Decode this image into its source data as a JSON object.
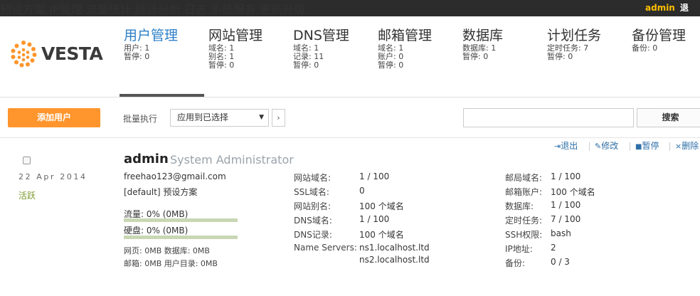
{
  "topnav": [
    "预设方案",
    "IP管理",
    "流量统计",
    "统计分析",
    "日志",
    "系统服务",
    "更新升级"
  ],
  "top_user": "admin",
  "top_logout": "退出",
  "logo_text": "VESTA",
  "colors": {
    "topbar": "#2c2c2c",
    "accent_orange": "#ff952c",
    "active_blue": "#2e80c8",
    "user_yellow": "#ffbf00",
    "status_green": "#7a9a2d"
  },
  "menu": [
    {
      "title": "用户管理",
      "stats": [
        "用户: 1",
        "暂停: 0"
      ]
    },
    {
      "title": "网站管理",
      "stats": [
        "域名: 1",
        "别名: 1",
        "暂停: 0"
      ]
    },
    {
      "title": "DNS管理",
      "stats": [
        "域名: 1",
        "记录: 11",
        "暂停: 0"
      ]
    },
    {
      "title": "邮箱管理",
      "stats": [
        "域名: 1",
        "账户: 0",
        "暂停: 0"
      ]
    },
    {
      "title": "数据库",
      "stats": [
        "数据库: 1",
        "暂停: 0"
      ]
    },
    {
      "title": "计划任务",
      "stats": [
        "定时任务: 7",
        "暂停: 0"
      ]
    },
    {
      "title": "备份管理",
      "stats": [
        "备份: 0"
      ]
    }
  ],
  "toolbar": {
    "add_label": "添加用户",
    "bulk_label": "批量执行",
    "bulk_value": "应用到已选择",
    "go_label": "›",
    "search_label": "搜索"
  },
  "actions": {
    "logout": "退出",
    "edit": "修改",
    "suspend": "暂停",
    "delete": "删除"
  },
  "user": {
    "date": "22 Apr 2014",
    "status": "活跃",
    "name": "admin",
    "fullname": "System Administrator",
    "email": "freehao123@gmail.com",
    "package": "[default] 预设方案",
    "bandwidth": "流量: 0% (0MB)",
    "bandwidth_pct": 0,
    "disk": "硬盘: 0% (0MB)",
    "disk_pct": 0,
    "usage1": "网页: 0MB 数据库: 0MB",
    "usage2": "邮箱: 0MB 用户目录: 0MB"
  },
  "col1": [
    {
      "k": "网站域名:",
      "v": "1 / 100"
    },
    {
      "k": "SSL域名:",
      "v": "0"
    },
    {
      "k": "网站别名:",
      "v": "100 个域名"
    },
    {
      "k": "DNS域名:",
      "v": "1 / 100"
    },
    {
      "k": "DNS记录:",
      "v": "100 个域名"
    },
    {
      "k": "Name Servers:",
      "v": "ns1.localhost.ltd"
    },
    {
      "k": "",
      "v": "ns2.localhost.ltd"
    }
  ],
  "col2": [
    {
      "k": "邮局域名:",
      "v": "1 / 100"
    },
    {
      "k": "邮箱账户:",
      "v": "100 个域名"
    },
    {
      "k": "数据库:",
      "v": "1 / 100"
    },
    {
      "k": "定时任务:",
      "v": "7 / 100"
    },
    {
      "k": "SSH权限:",
      "v": "bash"
    },
    {
      "k": "IP地址:",
      "v": "2"
    },
    {
      "k": "备份:",
      "v": "0 / 3"
    }
  ]
}
